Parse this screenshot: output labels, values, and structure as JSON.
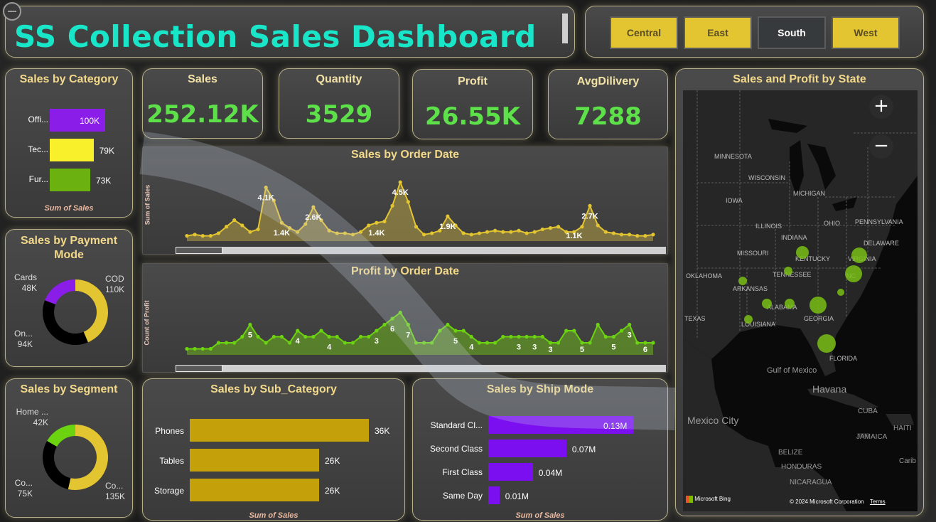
{
  "dashboard": {
    "title": "SS Collection Sales Dashboard",
    "regions": [
      {
        "label": "Central",
        "selected": false
      },
      {
        "label": "East",
        "selected": false
      },
      {
        "label": "South",
        "selected": true
      },
      {
        "label": "West",
        "selected": false
      }
    ]
  },
  "kpis": {
    "sales": {
      "label": "Sales",
      "value": "252.12K"
    },
    "quantity": {
      "label": "Quantity",
      "value": "3529"
    },
    "profit": {
      "label": "Profit",
      "value": "26.55K"
    },
    "avg_delivery": {
      "label": "AvgDilivery",
      "value": "7288"
    }
  },
  "colors": {
    "accent_title": "#19e6c8",
    "kpi_green": "#5ee04a",
    "panel_title": "#f2d98a",
    "slicer_yellow": "#e3c431",
    "purple": "#8a1ee8",
    "yellow": "#f7f02a",
    "green": "#6bb10f",
    "gold_bar": "#c4a00a",
    "ship_purple": "#7b0ff0"
  },
  "sales_by_category": {
    "title": "Sales by Category",
    "note": "Sum of Sales",
    "chart_data": {
      "type": "bar",
      "categories": [
        "Offi...",
        "Tec...",
        "Fur..."
      ],
      "values": [
        100,
        79,
        73
      ],
      "labels": [
        "100K",
        "79K",
        "73K"
      ]
    }
  },
  "sales_by_payment": {
    "title": "Sales by Payment Mode",
    "chart_data": {
      "type": "pie",
      "slices": [
        {
          "name": "COD",
          "value": 110,
          "label": "110K",
          "color": "#e3c431"
        },
        {
          "name": "On...",
          "value": 94,
          "label": "94K",
          "color": "#000000"
        },
        {
          "name": "Cards",
          "value": 48,
          "label": "48K",
          "color": "#8a1ee8"
        }
      ]
    }
  },
  "sales_by_segment": {
    "title": "Sales by Segment",
    "chart_data": {
      "type": "pie",
      "slices": [
        {
          "name": "Co...",
          "value": 135,
          "label": "135K",
          "color": "#e3c431"
        },
        {
          "name": "Co...",
          "value": 75,
          "label": "75K",
          "color": "#000000"
        },
        {
          "name": "Home ...",
          "value": 42,
          "label": "42K",
          "color": "#6bd30f"
        }
      ]
    }
  },
  "sales_by_order_date": {
    "title": "Sales by Order Date",
    "ylabel": "Sum of Sales",
    "chart_data": {
      "type": "area",
      "values": [
        0.4,
        0.5,
        0.4,
        0.4,
        0.6,
        1.1,
        1.6,
        1.2,
        0.7,
        0.9,
        4.1,
        3.1,
        1.4,
        1.0,
        0.7,
        1.3,
        2.6,
        1.6,
        0.8,
        0.6,
        0.6,
        0.5,
        0.7,
        1.2,
        1.4,
        1.5,
        2.7,
        4.5,
        3.0,
        1.1,
        0.5,
        0.6,
        0.8,
        1.9,
        1.2,
        0.6,
        0.5,
        0.6,
        0.7,
        0.8,
        0.7,
        0.7,
        0.8,
        0.6,
        0.7,
        0.9,
        1.0,
        1.1,
        0.7,
        0.7,
        1.1,
        2.7,
        1.2,
        0.7,
        0.6,
        0.5,
        0.5,
        0.4,
        0.4,
        0.5
      ],
      "annotations": [
        {
          "index": 10,
          "label": "4.1K"
        },
        {
          "index": 12,
          "label": "1.4K"
        },
        {
          "index": 16,
          "label": "2.6K"
        },
        {
          "index": 24,
          "label": "1.4K"
        },
        {
          "index": 27,
          "label": "4.5K"
        },
        {
          "index": 33,
          "label": "1.9K"
        },
        {
          "index": 49,
          "label": "1.1K"
        },
        {
          "index": 51,
          "label": "2.7K"
        }
      ],
      "ylim": [
        0,
        5
      ]
    }
  },
  "profit_by_order_date": {
    "title": "Profit by Order Date",
    "ylabel": "Count of Profit",
    "chart_data": {
      "type": "area",
      "values": [
        1,
        1,
        1,
        1,
        2,
        2,
        2,
        3,
        5,
        3,
        2,
        3,
        3,
        2,
        4,
        3,
        3,
        4,
        3,
        3,
        2,
        2,
        3,
        3,
        4,
        5,
        6,
        7,
        5,
        2,
        2,
        2,
        4,
        5,
        4,
        4,
        3,
        2,
        2,
        2,
        3,
        3,
        3,
        3,
        3,
        3,
        2,
        2,
        4,
        4,
        2,
        2,
        5,
        3,
        3,
        4,
        5,
        2,
        2,
        2
      ],
      "annotations": [
        {
          "index": 8,
          "label": "5"
        },
        {
          "index": 14,
          "label": "4"
        },
        {
          "index": 18,
          "label": "4"
        },
        {
          "index": 24,
          "label": "3"
        },
        {
          "index": 26,
          "label": "6"
        },
        {
          "index": 28,
          "label": "7"
        },
        {
          "index": 34,
          "label": "5"
        },
        {
          "index": 36,
          "label": "4"
        },
        {
          "index": 42,
          "label": "3"
        },
        {
          "index": 44,
          "label": "3"
        },
        {
          "index": 46,
          "label": "3"
        },
        {
          "index": 50,
          "label": "5"
        },
        {
          "index": 54,
          "label": "5"
        },
        {
          "index": 56,
          "label": "3"
        },
        {
          "index": 58,
          "label": "6"
        }
      ],
      "ylim": [
        0,
        8
      ]
    }
  },
  "sales_by_sub_category": {
    "title": "Sales by Sub_Category",
    "note": "Sum of Sales",
    "chart_data": {
      "type": "bar",
      "categories": [
        "Phones",
        "Tables",
        "Storage"
      ],
      "values": [
        36,
        26,
        26
      ],
      "labels": [
        "36K",
        "26K",
        "26K"
      ]
    }
  },
  "sales_by_ship_mode": {
    "title": "Sales by Ship Mode",
    "note": "Sum of Sales",
    "chart_data": {
      "type": "bar",
      "categories": [
        "Standard Cl...",
        "Second Class",
        "First Class",
        "Same Day"
      ],
      "values": [
        0.13,
        0.07,
        0.04,
        0.01
      ],
      "labels": [
        "0.13M",
        "0.07M",
        "0.04M",
        "0.01M"
      ]
    }
  },
  "map": {
    "title": "Sales and Profit by State",
    "state_labels": [
      "MINNESOTA",
      "WISCONSIN",
      "MICHIGAN",
      "IOWA",
      "ILLINOIS",
      "OHIO",
      "PENNSYLVANIA",
      "INDIANA",
      "MISSOURI",
      "KENTUCKY",
      "VIRGINIA",
      "DELAWARE",
      "OKLAHOMA",
      "TENNESSEE",
      "ARKANSAS",
      "NC",
      "ALABAMA",
      "GEORGIA",
      "TEXAS",
      "LOUISIANA",
      "FLORIDA"
    ],
    "places": [
      "Gulf of Mexico",
      "Havana",
      "CUBA",
      "Mexico City",
      "HAITI",
      "JAMAICA",
      "BELIZE",
      "HONDURAS",
      "NICARAGUA",
      "Carib"
    ],
    "attribution": "© 2024 Microsoft Corporation",
    "terms": "Terms",
    "brand": "Microsoft Bing",
    "zoom_in": "+",
    "zoom_out": "−"
  }
}
